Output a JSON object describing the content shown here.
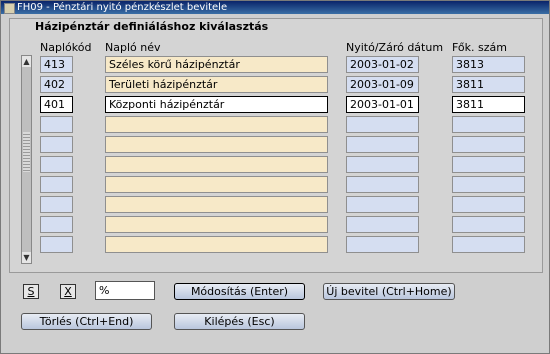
{
  "window": {
    "title": "FH09 - Pénztári nyitó pénzkészlet bevitele"
  },
  "section": {
    "heading": "Házipénztár definiáláshoz kiválasztás"
  },
  "columns": {
    "code": "Naplókód",
    "name": "Napló név",
    "date": "Nyitó/Záró dátum",
    "account": "Fők. szám"
  },
  "rows": [
    {
      "code": "413",
      "name": "Széles körű házipénztár",
      "date": "2003-01-02",
      "account": "3813"
    },
    {
      "code": "402",
      "name": "Területi házipénztár",
      "date": "2003-01-09",
      "account": "3811"
    },
    {
      "code": "401",
      "name": "Központi házipénztár",
      "date": "2003-01-01",
      "account": "3811",
      "current": true
    },
    {
      "code": "",
      "name": "",
      "date": "",
      "account": ""
    },
    {
      "code": "",
      "name": "",
      "date": "",
      "account": ""
    },
    {
      "code": "",
      "name": "",
      "date": "",
      "account": ""
    },
    {
      "code": "",
      "name": "",
      "date": "",
      "account": ""
    },
    {
      "code": "",
      "name": "",
      "date": "",
      "account": ""
    },
    {
      "code": "",
      "name": "",
      "date": "",
      "account": ""
    },
    {
      "code": "",
      "name": "",
      "date": "",
      "account": ""
    }
  ],
  "controls": {
    "s_label": "S",
    "x_label": "X",
    "filter_value": "%",
    "modify": "Módosítás (Enter)",
    "new_entry": "Új bevitel (Ctrl+Home)",
    "delete": "Törlés (Ctrl+End)",
    "exit": "Kilépés (Esc)"
  },
  "icons": {
    "window": "app-icon",
    "scroll_up": "arrow-up-icon",
    "scroll_down": "arrow-down-icon"
  }
}
